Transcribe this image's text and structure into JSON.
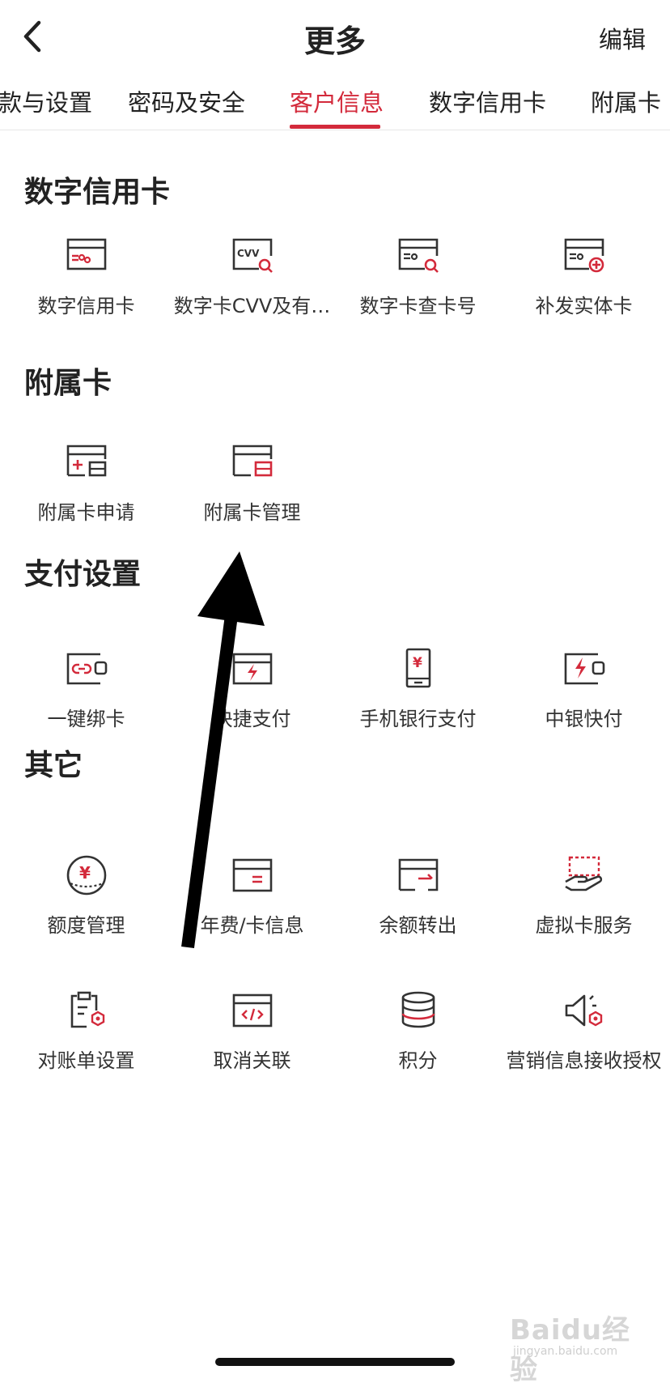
{
  "header": {
    "title": "更多",
    "edit_label": "编辑"
  },
  "tabs": [
    {
      "label": "款与设置",
      "active": false
    },
    {
      "label": "密码及安全",
      "active": false
    },
    {
      "label": "客户信息",
      "active": true
    },
    {
      "label": "数字信用卡",
      "active": false
    },
    {
      "label": "附属卡",
      "active": false
    }
  ],
  "sections": [
    {
      "title": "数字信用卡",
      "items": [
        {
          "label": "数字信用卡",
          "icon": "digital-card-icon"
        },
        {
          "label": "数字卡CVV及有…",
          "icon": "cvv-search-icon"
        },
        {
          "label": "数字卡查卡号",
          "icon": "card-number-search-icon"
        },
        {
          "label": "补发实体卡",
          "icon": "reissue-card-icon"
        }
      ]
    },
    {
      "title": "附属卡",
      "items": [
        {
          "label": "附属卡申请",
          "icon": "supplementary-apply-icon"
        },
        {
          "label": "附属卡管理",
          "icon": "supplementary-manage-icon"
        }
      ]
    },
    {
      "title": "支付设置",
      "items": [
        {
          "label": "一键绑卡",
          "icon": "bind-card-icon"
        },
        {
          "label": "快捷支付",
          "icon": "quick-pay-icon"
        },
        {
          "label": "手机银行支付",
          "icon": "mobile-bank-pay-icon"
        },
        {
          "label": "中银快付",
          "icon": "boc-quick-pay-icon"
        }
      ]
    },
    {
      "title": "其它",
      "items": [
        {
          "label": "额度管理",
          "icon": "credit-limit-icon"
        },
        {
          "label": "年费/卡信息",
          "icon": "annual-fee-icon"
        },
        {
          "label": "余额转出",
          "icon": "balance-transfer-icon"
        },
        {
          "label": "虚拟卡服务",
          "icon": "virtual-card-icon"
        },
        {
          "label": "对账单设置",
          "icon": "statement-settings-icon"
        },
        {
          "label": "取消关联",
          "icon": "unlink-icon"
        },
        {
          "label": "积分",
          "icon": "points-icon"
        },
        {
          "label": "营销信息接收授权",
          "icon": "marketing-auth-icon"
        }
      ]
    }
  ],
  "watermark": {
    "main": "Baidu经验",
    "sub": "jingyan.baidu.com"
  },
  "colors": {
    "accent": "#d32a3b",
    "text": "#222222",
    "icon_stroke": "#333333"
  }
}
